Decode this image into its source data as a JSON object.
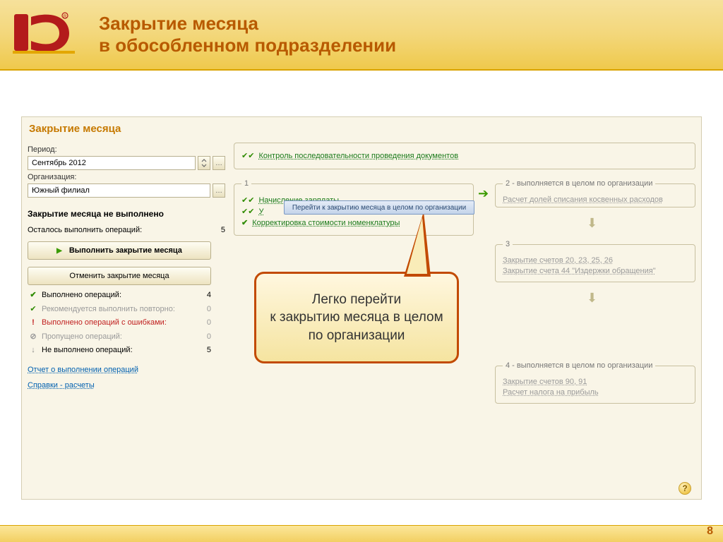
{
  "slide": {
    "title_line1": "Закрытие месяца",
    "title_line2": "в обособленном подразделении",
    "page_number": "8"
  },
  "app": {
    "title": "Закрытие месяца",
    "period_label": "Период:",
    "period_value": "Сентябрь 2012",
    "org_label": "Организация:",
    "org_value": "Южный филиал",
    "status_title": "Закрытие месяца не выполнено",
    "remaining_label": "Осталось выполнить операций:",
    "remaining_value": "5",
    "btn_execute": "Выполнить закрытие месяца",
    "btn_cancel": "Отменить закрытие месяца",
    "stats": {
      "done_label": "Выполнено операций:",
      "done_value": "4",
      "repeat_label": "Рекомендуется выполнить повторно:",
      "repeat_value": "0",
      "errors_label": "Выполнено операций с ошибками:",
      "errors_value": "0",
      "skipped_label": "Пропущено операций:",
      "skipped_value": "0",
      "notdone_label": "Не выполнено операций:",
      "notdone_value": "5"
    },
    "link_report": "Отчет о выполнении операций",
    "link_refs": "Справки - расчеты"
  },
  "top_op": "Контроль последовательности проведения документов",
  "box1": {
    "legend": "1",
    "op1": "Начисление зарплаты",
    "op2": "У",
    "op3": "Корректировка стоимости номенклатуры"
  },
  "box2": {
    "legend": "2  - выполняется в целом по организации",
    "op1": "Расчет долей списания косвенных расходов"
  },
  "box3": {
    "legend": "3",
    "op1": "Закрытие счетов 20, 23, 25, 26",
    "op2": "Закрытие счета 44 \"Издержки обращения\""
  },
  "box4": {
    "legend": "4  - выполняется в целом по организации",
    "op1": "Закрытие счетов 90, 91",
    "op2": "Расчет налога на прибыль"
  },
  "tooltip": "Перейти к закрытию месяца в целом по организации",
  "callout": "Легко перейти\nк закрытию месяца в целом\nпо организации"
}
